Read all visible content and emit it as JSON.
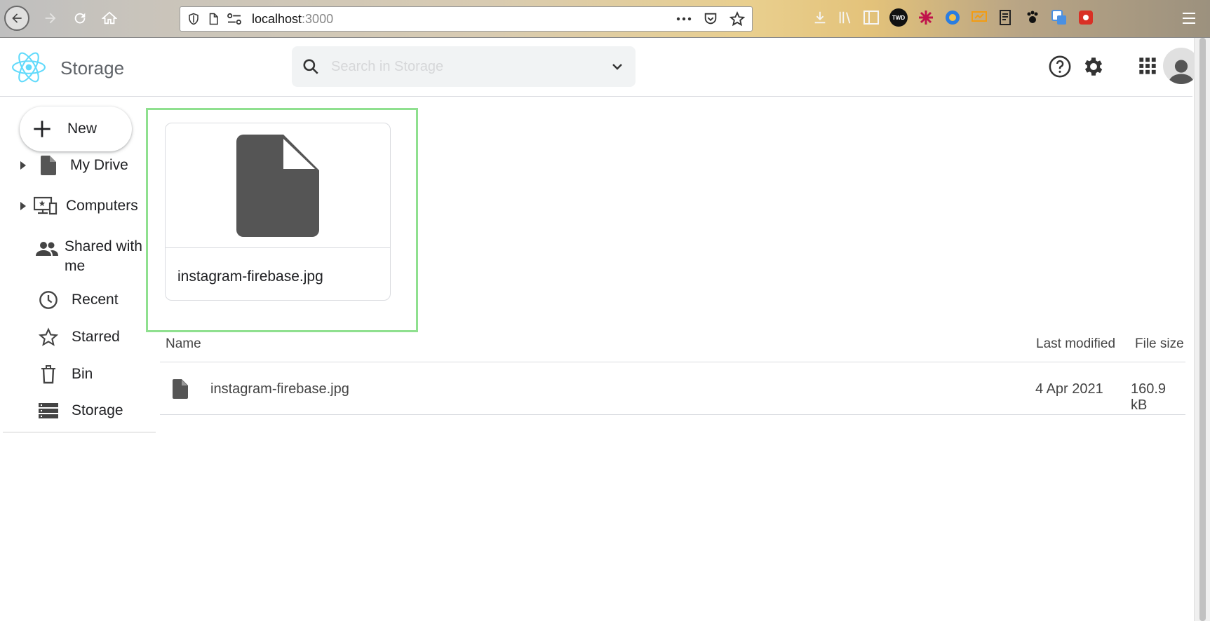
{
  "browser": {
    "url_host": "localhost",
    "url_port": ":3000",
    "ext_label": "TWD"
  },
  "header": {
    "app_title": "Storage",
    "search_placeholder": "Search in Storage"
  },
  "sidebar": {
    "new_label": "New",
    "items": [
      {
        "label": "My Drive",
        "icon": "file-icon",
        "expandable": true
      },
      {
        "label": "Computers",
        "icon": "computers-icon",
        "expandable": true
      },
      {
        "label": "Shared with",
        "label2": "me",
        "icon": "people-icon",
        "expandable": false
      },
      {
        "label": "Recent",
        "icon": "clock-icon",
        "expandable": false
      },
      {
        "label": "Starred",
        "icon": "star-icon",
        "expandable": false
      },
      {
        "label": "Bin",
        "icon": "trash-icon",
        "expandable": false
      },
      {
        "label": "Storage",
        "icon": "storage-icon",
        "expandable": false
      }
    ]
  },
  "main": {
    "card": {
      "file_name": "instagram-firebase.jpg"
    },
    "table": {
      "columns": {
        "name": "Name",
        "modified": "Last modified",
        "size": "File size"
      },
      "rows": [
        {
          "name": "instagram-firebase.jpg",
          "modified": "4 Apr 2021",
          "size": "160.9 kB"
        }
      ]
    }
  },
  "colors": {
    "highlight_border": "#8fe08f",
    "react_logo": "#61dafb",
    "icon_dark": "#555555"
  }
}
